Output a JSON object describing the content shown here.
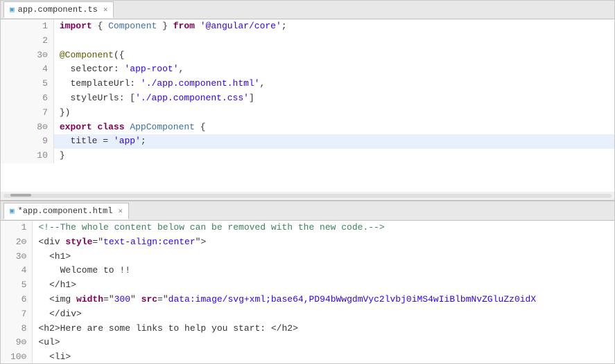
{
  "pane_top": {
    "tab": {
      "icon": "📄",
      "name": "app.component.ts",
      "close": "✕"
    },
    "lines": [
      {
        "num": 1,
        "tokens": [
          {
            "type": "kw-import",
            "text": "import"
          },
          {
            "type": "punct",
            "text": " { "
          },
          {
            "type": "angular-comp",
            "text": "Component"
          },
          {
            "type": "punct",
            "text": " } "
          },
          {
            "type": "kw-from",
            "text": "from"
          },
          {
            "type": "punct",
            "text": " "
          },
          {
            "type": "str",
            "text": "'@angular/core'"
          },
          {
            "type": "punct",
            "text": ";"
          }
        ]
      },
      {
        "num": 2,
        "tokens": []
      },
      {
        "num": "3⊖",
        "tokens": [
          {
            "type": "decorator",
            "text": "@Component"
          },
          {
            "type": "punct",
            "text": "({"
          }
        ]
      },
      {
        "num": 4,
        "tokens": [
          {
            "type": "prop",
            "text": "  selector"
          },
          {
            "type": "punct",
            "text": ": "
          },
          {
            "type": "str",
            "text": "'app-root'"
          },
          {
            "type": "punct",
            "text": ","
          }
        ]
      },
      {
        "num": 5,
        "tokens": [
          {
            "type": "prop",
            "text": "  templateUrl"
          },
          {
            "type": "punct",
            "text": ": "
          },
          {
            "type": "str",
            "text": "'./app.component.html'"
          },
          {
            "type": "punct",
            "text": ","
          }
        ]
      },
      {
        "num": 6,
        "tokens": [
          {
            "type": "prop",
            "text": "  styleUrls"
          },
          {
            "type": "punct",
            "text": ": ["
          },
          {
            "type": "str",
            "text": "'./app.component.css'"
          },
          {
            "type": "punct",
            "text": "]"
          }
        ]
      },
      {
        "num": 7,
        "tokens": [
          {
            "type": "punct",
            "text": "})"
          }
        ]
      },
      {
        "num": "8⊖",
        "tokens": [
          {
            "type": "kw-export",
            "text": "export"
          },
          {
            "type": "punct",
            "text": " "
          },
          {
            "type": "kw-class",
            "text": "class"
          },
          {
            "type": "punct",
            "text": " "
          },
          {
            "type": "angular-comp",
            "text": "AppComponent"
          },
          {
            "type": "punct",
            "text": " {"
          }
        ]
      },
      {
        "num": 9,
        "tokens": [
          {
            "type": "prop",
            "text": "  title"
          },
          {
            "type": "punct",
            "text": " = "
          },
          {
            "type": "str",
            "text": "'app'"
          },
          {
            "type": "punct",
            "text": ";"
          }
        ],
        "highlight": true
      },
      {
        "num": 10,
        "tokens": [
          {
            "type": "punct",
            "text": "}"
          }
        ]
      }
    ]
  },
  "pane_bottom": {
    "tab": {
      "icon": "📄",
      "name": "*app.component.html",
      "close": "✕"
    },
    "lines": [
      {
        "num": 1,
        "tokens": [
          {
            "type": "html-comment",
            "text": "<!--The whole content below can be removed with the new code.-->"
          }
        ]
      },
      {
        "num": "2⊖",
        "tokens": [
          {
            "type": "punct",
            "text": "<"
          },
          {
            "type": "html-tag",
            "text": "div"
          },
          {
            "type": "punct",
            "text": " "
          },
          {
            "type": "attr-name",
            "text": "style"
          },
          {
            "type": "punct",
            "text": "=\""
          },
          {
            "type": "attr-val",
            "text": "text-align:center"
          },
          {
            "type": "punct",
            "text": "\">"
          }
        ]
      },
      {
        "num": "3⊖",
        "tokens": [
          {
            "type": "punct",
            "text": "  <"
          },
          {
            "type": "html-tag",
            "text": "h1"
          },
          {
            "type": "punct",
            "text": ">"
          }
        ]
      },
      {
        "num": 4,
        "tokens": [
          {
            "type": "punct",
            "text": "    Welcome to !!"
          }
        ]
      },
      {
        "num": 5,
        "tokens": [
          {
            "type": "punct",
            "text": "  </"
          },
          {
            "type": "html-tag",
            "text": "h1"
          },
          {
            "type": "punct",
            "text": ">"
          }
        ]
      },
      {
        "num": 6,
        "tokens": [
          {
            "type": "punct",
            "text": "  <"
          },
          {
            "type": "html-tag",
            "text": "img"
          },
          {
            "type": "punct",
            "text": " "
          },
          {
            "type": "attr-name",
            "text": "width"
          },
          {
            "type": "punct",
            "text": "=\""
          },
          {
            "type": "xml-attr",
            "text": "300"
          },
          {
            "type": "punct",
            "text": "\" "
          },
          {
            "type": "attr-name",
            "text": "src"
          },
          {
            "type": "punct",
            "text": "=\""
          },
          {
            "type": "xml-attr",
            "text": "data:image/svg+xml;base64,PD94bWwgdmVyc2lvbj0iMS4wIiBlbmNvZGluZz0idX"
          },
          {
            "type": "punct",
            "text": ""
          }
        ]
      },
      {
        "num": 7,
        "tokens": [
          {
            "type": "punct",
            "text": "  </"
          },
          {
            "type": "html-tag",
            "text": "div"
          },
          {
            "type": "punct",
            "text": ">"
          }
        ]
      },
      {
        "num": 8,
        "tokens": [
          {
            "type": "punct",
            "text": "<"
          },
          {
            "type": "html-tag",
            "text": "h2"
          },
          {
            "type": "punct",
            "text": ">Here are some links to help you start: </"
          },
          {
            "type": "html-tag",
            "text": "h2"
          },
          {
            "type": "punct",
            "text": ">"
          }
        ]
      },
      {
        "num": "9⊖",
        "tokens": [
          {
            "type": "punct",
            "text": "<"
          },
          {
            "type": "html-tag",
            "text": "ul"
          },
          {
            "type": "punct",
            "text": ">"
          }
        ]
      },
      {
        "num": "10⊖",
        "tokens": [
          {
            "type": "punct",
            "text": "  <"
          },
          {
            "type": "html-tag",
            "text": "li"
          },
          {
            "type": "punct",
            "text": ">"
          }
        ]
      }
    ]
  }
}
